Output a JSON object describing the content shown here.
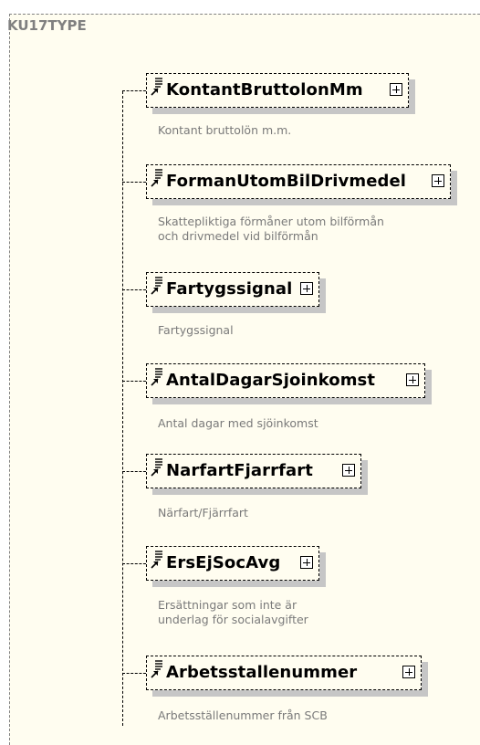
{
  "type_name": "KU17TYPE",
  "elements": [
    {
      "name": "KontantBruttolonMm",
      "desc": [
        "Kontant bruttolön m.m."
      ]
    },
    {
      "name": "FormanUtomBilDrivmedel",
      "desc": [
        "Skattepliktiga förmåner utom bilförmån",
        "och drivmedel vid bilförmån"
      ]
    },
    {
      "name": "Fartygssignal",
      "desc": [
        "Fartygssignal"
      ]
    },
    {
      "name": "AntalDagarSjoinkomst",
      "desc": [
        "Antal dagar med sjöinkomst"
      ]
    },
    {
      "name": "NarfartFjarrfart",
      "desc": [
        "Närfart/Fjärrfart"
      ]
    },
    {
      "name": "ErsEjSocAvg",
      "desc": [
        "Ersättningar som inte är",
        "underlag för socialavgifter"
      ]
    },
    {
      "name": "Arbetsstallenummer",
      "desc": [
        "Arbetsställenummer från SCB"
      ]
    }
  ]
}
